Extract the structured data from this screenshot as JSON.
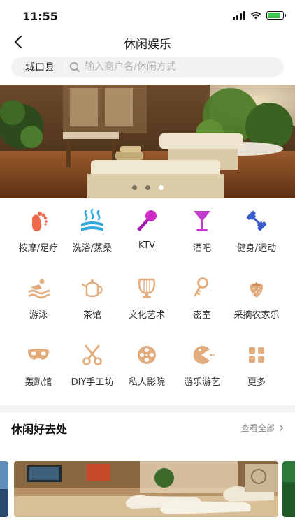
{
  "status_bar": {
    "time": "11:55",
    "battery_level": 0.8,
    "battery_color": "#3ac24c"
  },
  "nav": {
    "title": "休闲娱乐",
    "back_icon": "chevron-left-icon"
  },
  "search": {
    "city": "城口县",
    "placeholder": "输入商户名/休闲方式"
  },
  "banner": {
    "slide_count": 3,
    "active_slide": 3
  },
  "categories": [
    {
      "label": "按摩/足疗",
      "icon": "footprint-icon",
      "color": "#f06a4e"
    },
    {
      "label": "洗浴/蒸桑",
      "icon": "steam-bath-icon",
      "color": "#2fa8e0"
    },
    {
      "label": "KTV",
      "icon": "microphone-icon",
      "color": "#d02cc6"
    },
    {
      "label": "酒吧",
      "icon": "cocktail-icon",
      "color": "#c43bd0"
    },
    {
      "label": "健身/运动",
      "icon": "dumbbell-icon",
      "color": "#3b5ccc"
    },
    {
      "label": "游泳",
      "icon": "swim-icon",
      "color": "#e3ac7c"
    },
    {
      "label": "茶馆",
      "icon": "teapot-icon",
      "color": "#e3ac7c"
    },
    {
      "label": "文化艺术",
      "icon": "lyre-icon",
      "color": "#e3ac7c"
    },
    {
      "label": "密室",
      "icon": "key-icon",
      "color": "#e3ac7c"
    },
    {
      "label": "采摘农家乐",
      "icon": "strawberry-icon",
      "color": "#e3ac7c"
    },
    {
      "label": "轰趴馆",
      "icon": "party-mask-icon",
      "color": "#e3ac7c"
    },
    {
      "label": "DIY手工坊",
      "icon": "scissors-icon",
      "color": "#e3ac7c"
    },
    {
      "label": "私人影院",
      "icon": "film-reel-icon",
      "color": "#e3ac7c"
    },
    {
      "label": "游乐游艺",
      "icon": "pacman-icon",
      "color": "#e3ac7c"
    },
    {
      "label": "更多",
      "icon": "grid-more-icon",
      "color": "#e3ac7c"
    }
  ],
  "section": {
    "title": "休闲好去处",
    "view_all": "查看全部"
  }
}
